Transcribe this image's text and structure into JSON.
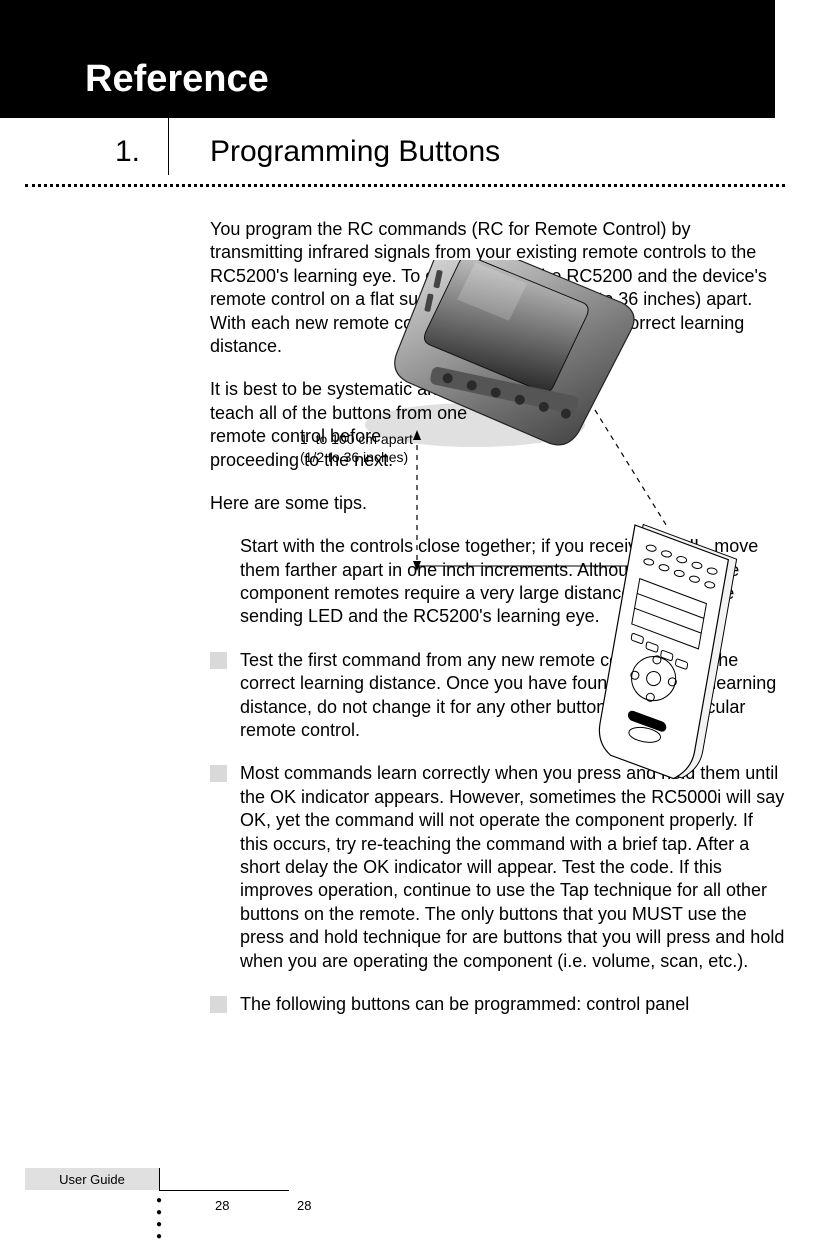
{
  "banner": {
    "title": "Reference"
  },
  "section": {
    "number": "1.",
    "title": "Programming Buttons"
  },
  "body": {
    "intro": "You program the RC commands (RC for Remote Control) by transmitting infrared signals from your existing remote controls to the RC5200's learning eye. To do this, place the RC5200 and the device's remote control on a flat surface, 1 to 100cm (1/2 to 36 inches) apart.\nWith each new remote control, you have to find the correct learning distance.",
    "para2": "It is best to be systematic and teach all of the buttons from one remote control before proceeding to the next.",
    "para3": "Here are some tips.",
    "tips": [
      "Start with the controls close together; if you receive a FAIL, move them farther apart in one inch increments. Although rare, some component remotes require a very large distance between the sending LED and the RC5200's learning eye.",
      "Test the first command from any new remote control to find the correct learning distance. Once you have found the correct learning distance, do not change it for any other button on that particular remote control.",
      "Most commands learn correctly when you press and hold them until the OK indicator appears. However, sometimes the RC5000i will say OK, yet the command will not operate the component properly. If this occurs, try re-teaching the command with a brief tap. After a short delay the OK indicator will appear. Test the code. If this improves operation, continue to use the Tap technique for all other buttons on the remote. The only buttons that you MUST use the press and hold technique for are buttons that you will press and hold when you are operating the component (i.e. volume, scan, etc.).",
      "The following buttons can be programmed: control panel"
    ]
  },
  "illustration": {
    "distance_label": "1  to 100 cm apart\n(1/2 to 36 inches)"
  },
  "footer": {
    "user_guide": "User Guide",
    "page_a": "28",
    "page_b": "28"
  }
}
